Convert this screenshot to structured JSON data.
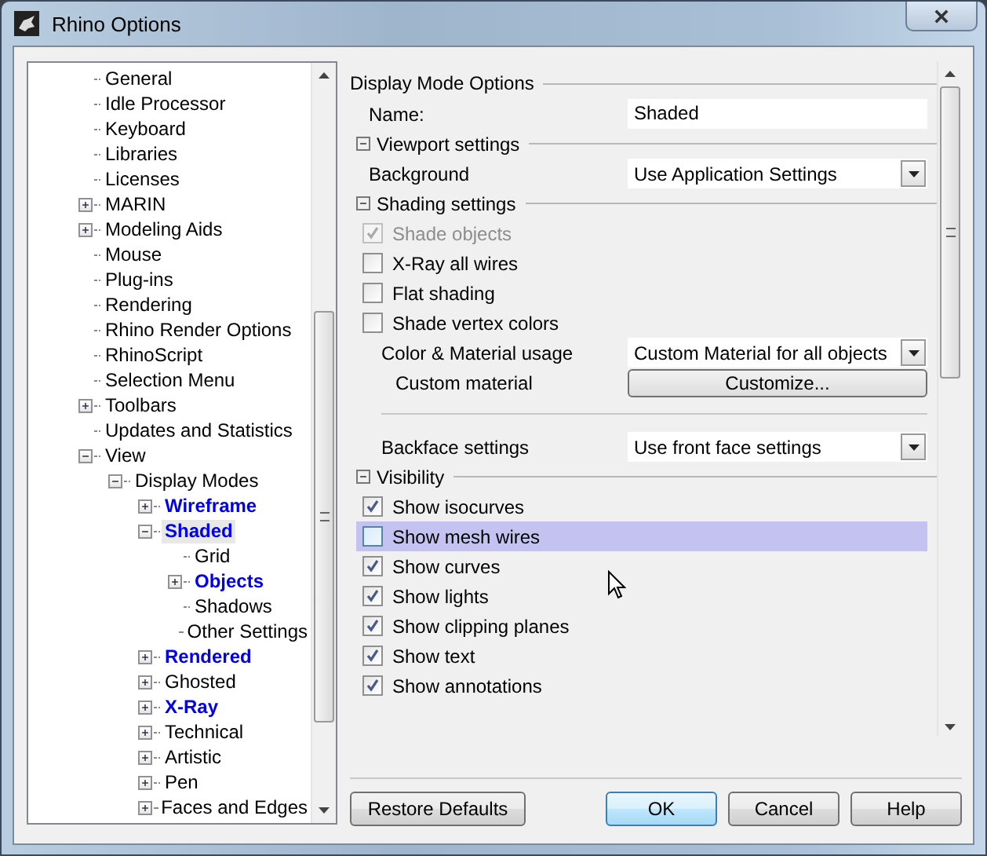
{
  "window": {
    "title": "Rhino Options"
  },
  "tree": [
    {
      "label": "General",
      "kind": "leaf",
      "selected": false,
      "modified": false
    },
    {
      "label": "Idle Processor",
      "kind": "leaf",
      "selected": false,
      "modified": false
    },
    {
      "label": "Keyboard",
      "kind": "leaf",
      "selected": false,
      "modified": false
    },
    {
      "label": "Libraries",
      "kind": "leaf",
      "selected": false,
      "modified": false
    },
    {
      "label": "Licenses",
      "kind": "leaf",
      "selected": false,
      "modified": false
    },
    {
      "label": "MARIN",
      "kind": "node",
      "expanded": false,
      "selected": false,
      "modified": false
    },
    {
      "label": "Modeling Aids",
      "kind": "node",
      "expanded": false,
      "selected": false,
      "modified": false
    },
    {
      "label": "Mouse",
      "kind": "leaf",
      "selected": false,
      "modified": false
    },
    {
      "label": "Plug-ins",
      "kind": "leaf",
      "selected": false,
      "modified": false
    },
    {
      "label": "Rendering",
      "kind": "leaf",
      "selected": false,
      "modified": false
    },
    {
      "label": "Rhino Render Options",
      "kind": "leaf",
      "selected": false,
      "modified": false
    },
    {
      "label": "RhinoScript",
      "kind": "leaf",
      "selected": false,
      "modified": false
    },
    {
      "label": "Selection Menu",
      "kind": "leaf",
      "selected": false,
      "modified": false
    },
    {
      "label": "Toolbars",
      "kind": "node",
      "expanded": false,
      "selected": false,
      "modified": false
    },
    {
      "label": "Updates and Statistics",
      "kind": "leaf",
      "selected": false,
      "modified": false
    },
    {
      "label": "View",
      "kind": "node",
      "expanded": true,
      "selected": false,
      "modified": false,
      "children": [
        {
          "label": "Display Modes",
          "kind": "node",
          "expanded": true,
          "selected": false,
          "modified": false,
          "children": [
            {
              "label": "Wireframe",
              "kind": "node",
              "expanded": false,
              "selected": false,
              "modified": true
            },
            {
              "label": "Shaded",
              "kind": "node",
              "expanded": true,
              "selected": true,
              "modified": true,
              "children": [
                {
                  "label": "Grid",
                  "kind": "leaf",
                  "selected": false,
                  "modified": false
                },
                {
                  "label": "Objects",
                  "kind": "node",
                  "expanded": false,
                  "selected": false,
                  "modified": true
                },
                {
                  "label": "Shadows",
                  "kind": "leaf",
                  "selected": false,
                  "modified": false
                },
                {
                  "label": "Other Settings",
                  "kind": "leaf",
                  "selected": false,
                  "modified": false
                }
              ]
            },
            {
              "label": "Rendered",
              "kind": "node",
              "expanded": false,
              "selected": false,
              "modified": true
            },
            {
              "label": "Ghosted",
              "kind": "node",
              "expanded": false,
              "selected": false,
              "modified": false
            },
            {
              "label": "X-Ray",
              "kind": "node",
              "expanded": false,
              "selected": false,
              "modified": true
            },
            {
              "label": "Technical",
              "kind": "node",
              "expanded": false,
              "selected": false,
              "modified": false
            },
            {
              "label": "Artistic",
              "kind": "node",
              "expanded": false,
              "selected": false,
              "modified": false
            },
            {
              "label": "Pen",
              "kind": "node",
              "expanded": false,
              "selected": false,
              "modified": false
            },
            {
              "label": "Faces and Edges",
              "kind": "node",
              "expanded": false,
              "selected": false,
              "modified": false
            }
          ]
        }
      ]
    }
  ],
  "options": [
    {
      "kind": "heading",
      "label": "Display Mode Options"
    },
    {
      "kind": "text",
      "label": "Name:",
      "value": "Shaded"
    },
    {
      "kind": "section",
      "label": "Viewport settings",
      "expanded": true
    },
    {
      "kind": "select",
      "label": "Background",
      "value": "Use Application Settings",
      "nested": false
    },
    {
      "kind": "section",
      "label": "Shading settings",
      "expanded": true
    },
    {
      "kind": "checkbox",
      "label": "Shade objects",
      "checked": true,
      "disabled": true,
      "hovered": false
    },
    {
      "kind": "checkbox",
      "label": "X-Ray all wires",
      "checked": false,
      "disabled": false,
      "hovered": false
    },
    {
      "kind": "checkbox",
      "label": "Flat shading",
      "checked": false,
      "disabled": false,
      "hovered": false
    },
    {
      "kind": "checkbox",
      "label": "Shade vertex colors",
      "checked": false,
      "disabled": false,
      "hovered": false
    },
    {
      "kind": "select",
      "label": "Color & Material usage",
      "value": "Custom Material for all objects",
      "nested": true
    },
    {
      "kind": "button",
      "label": "Custom material",
      "value": "Customize..."
    },
    {
      "kind": "separator"
    },
    {
      "kind": "select",
      "label": "Backface settings",
      "value": "Use front face settings",
      "nested": true
    },
    {
      "kind": "section",
      "label": "Visibility",
      "expanded": true
    },
    {
      "kind": "checkbox",
      "label": "Show isocurves",
      "checked": true,
      "disabled": false,
      "hovered": false
    },
    {
      "kind": "checkbox",
      "label": "Show mesh wires",
      "checked": false,
      "disabled": false,
      "hovered": true
    },
    {
      "kind": "checkbox",
      "label": "Show curves",
      "checked": true,
      "disabled": false,
      "hovered": false
    },
    {
      "kind": "checkbox",
      "label": "Show lights",
      "checked": true,
      "disabled": false,
      "hovered": false
    },
    {
      "kind": "checkbox",
      "label": "Show clipping planes",
      "checked": true,
      "disabled": false,
      "hovered": false
    },
    {
      "kind": "checkbox",
      "label": "Show text",
      "checked": true,
      "disabled": false,
      "hovered": false
    },
    {
      "kind": "checkbox",
      "label": "Show annotations",
      "checked": true,
      "disabled": false,
      "hovered": false
    }
  ],
  "buttons": [
    {
      "label": "Restore Defaults",
      "default": false
    },
    {
      "label": "OK",
      "default": true
    },
    {
      "label": "Cancel",
      "default": false
    },
    {
      "label": "Help",
      "default": false
    }
  ]
}
